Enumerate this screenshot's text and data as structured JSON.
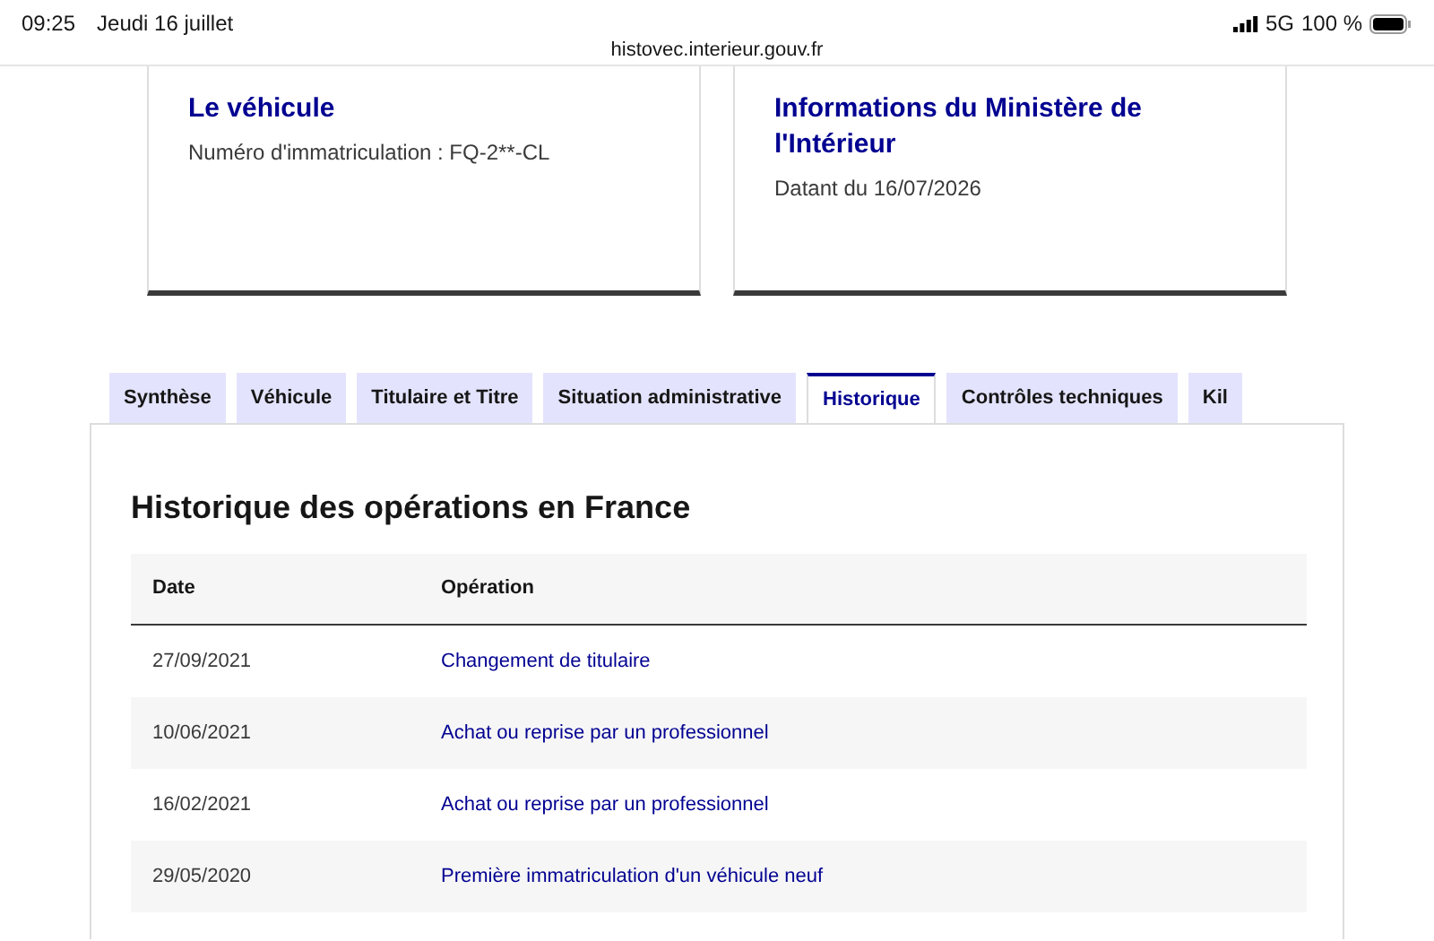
{
  "status_bar": {
    "time": "09:25",
    "date": "Jeudi 16 juillet",
    "network": "5G",
    "battery": "100 %"
  },
  "address_bar": {
    "url": "histovec.interieur.gouv.fr"
  },
  "cards": [
    {
      "title": "Le véhicule",
      "text": "Numéro d'immatriculation : FQ-2**-CL"
    },
    {
      "title": "Informations du Ministère de l'Intérieur",
      "text": "Datant du 16/07/2026"
    }
  ],
  "tabs": [
    {
      "label": "Synthèse",
      "selected": false
    },
    {
      "label": "Véhicule",
      "selected": false
    },
    {
      "label": "Titulaire et Titre",
      "selected": false
    },
    {
      "label": "Situation administrative",
      "selected": false
    },
    {
      "label": "Historique",
      "selected": true
    },
    {
      "label": "Contrôles techniques",
      "selected": false
    },
    {
      "label": "Kil",
      "selected": false
    }
  ],
  "panel": {
    "heading": "Historique des opérations en France",
    "table": {
      "columns": [
        "Date",
        "Opération"
      ],
      "rows": [
        [
          "27/09/2021",
          "Changement de titulaire"
        ],
        [
          "10/06/2021",
          "Achat ou reprise par un professionnel"
        ],
        [
          "16/02/2021",
          "Achat ou reprise par un professionnel"
        ],
        [
          "29/05/2020",
          "Première immatriculation d'un véhicule neuf"
        ]
      ]
    }
  }
}
